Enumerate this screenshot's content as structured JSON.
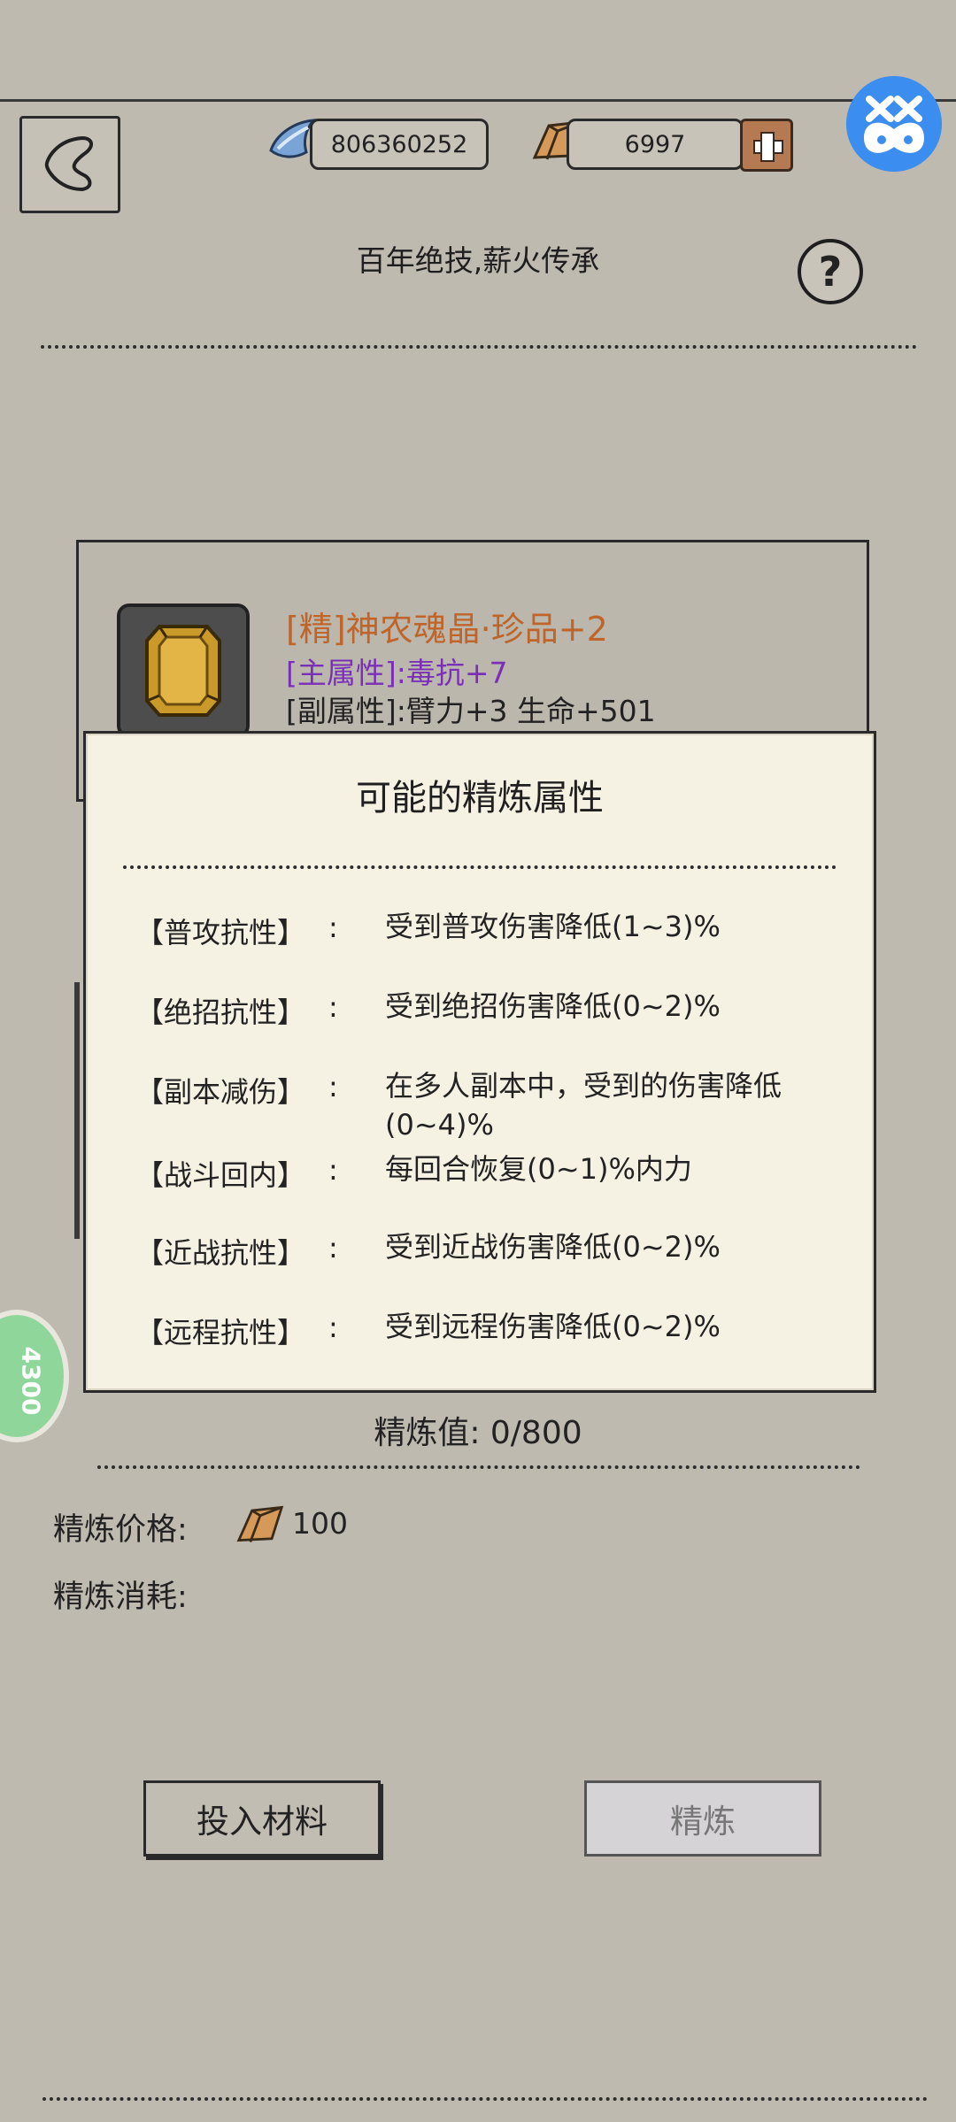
{
  "header": {
    "currency_1_value": "806360252",
    "currency_2_value": "6997",
    "subtitle": "百年绝技,薪火传承",
    "help_label": "?"
  },
  "item": {
    "name": "[精]神农魂晶·珍品+2",
    "main_attr": "[主属性]:毒抗+7",
    "sub_attr": "[副属性]:臂力+3 生命+501"
  },
  "modal": {
    "title": "可能的精炼属性",
    "rows": [
      {
        "label": "【普攻抗性】",
        "colon": ":",
        "desc": "受到普攻伤害降低(1~3)%"
      },
      {
        "label": "【绝招抗性】",
        "colon": ":",
        "desc": "受到绝招伤害降低(0~2)%"
      },
      {
        "label": "【副本减伤】",
        "colon": ":",
        "desc": "在多人副本中，受到的伤害降低(0~4)%"
      },
      {
        "label": "【战斗回内】",
        "colon": ":",
        "desc": "每回合恢复(0~1)%内力"
      },
      {
        "label": "【近战抗性】",
        "colon": ":",
        "desc": "受到近战伤害降低(0~2)%"
      },
      {
        "label": "【远程抗性】",
        "colon": ":",
        "desc": "受到远程伤害降低(0~2)%"
      }
    ]
  },
  "refine": {
    "value_text": "精炼值:  0/800",
    "price_label": "精炼价格:",
    "price_value": "100",
    "cost_label": "精炼消耗:"
  },
  "buttons": {
    "put_material": "投入材料",
    "refine": "精炼"
  },
  "side_badge": "4300",
  "colors": {
    "background": "#bfbab0",
    "item_name": "#c0652a",
    "main_attr": "#7a2fb8",
    "modal_bg": "#f6f2e3",
    "disabled_button": "#d6d3d6"
  }
}
